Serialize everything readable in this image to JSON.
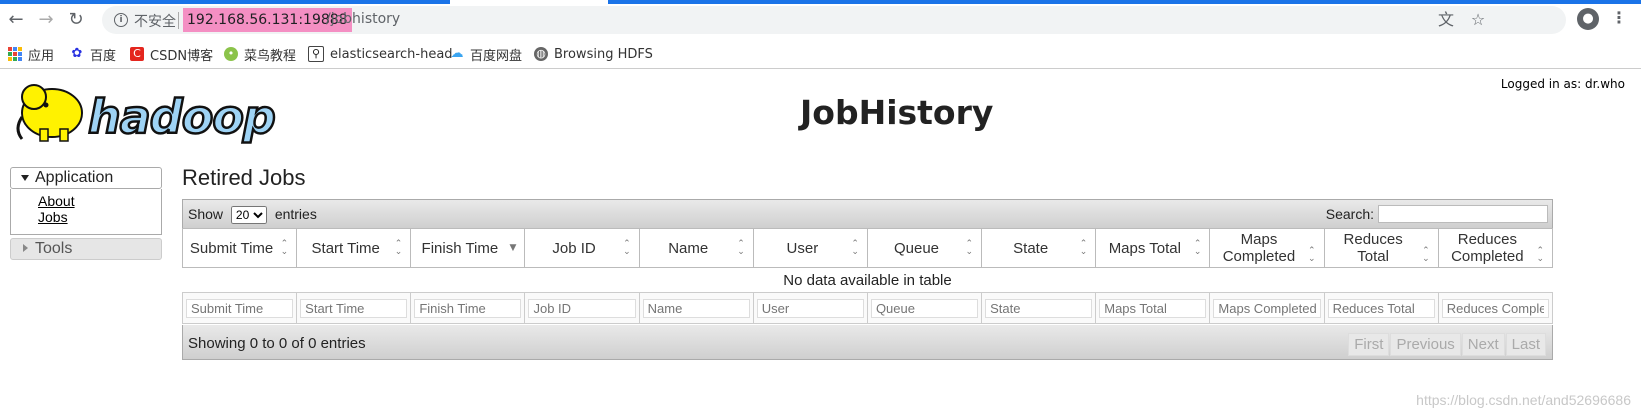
{
  "browser": {
    "insecure_label": "不安全",
    "url_host": "192.168.56.131:19888",
    "url_path": "/jobhistory",
    "bookmarks": [
      {
        "label": "应用",
        "icon": "apps-grid-icon"
      },
      {
        "label": "百度",
        "icon": "baidu-paw-icon"
      },
      {
        "label": "CSDN博客",
        "icon": "csdn-icon"
      },
      {
        "label": "菜鸟教程",
        "icon": "runoob-icon"
      },
      {
        "label": "elasticsearch-head",
        "icon": "elasticsearch-icon"
      },
      {
        "label": "百度网盘",
        "icon": "baidu-pan-icon"
      },
      {
        "label": "Browsing HDFS",
        "icon": "globe-icon"
      }
    ]
  },
  "header": {
    "logged_in": "Logged in as: dr.who",
    "title": "JobHistory"
  },
  "sidebar": {
    "application": "Application",
    "links": [
      "About",
      "Jobs"
    ],
    "tools": "Tools"
  },
  "main": {
    "title": "Retired Jobs",
    "show_prefix": "Show",
    "show_value": "20",
    "show_suffix": "entries",
    "search_label": "Search:",
    "columns": [
      "Submit Time",
      "Start Time",
      "Finish Time",
      "Job ID",
      "Name",
      "User",
      "Queue",
      "State",
      "Maps Total",
      "Maps Completed",
      "Reduces Total",
      "Reduces Completed"
    ],
    "empty_message": "No data available in table",
    "filter_placeholders": [
      "Submit Time",
      "Start Time",
      "Finish Time",
      "Job ID",
      "Name",
      "User",
      "Queue",
      "State",
      "Maps Total",
      "Maps Completed",
      "Reduces Total",
      "Reduces Completed"
    ],
    "info": "Showing 0 to 0 of 0 entries",
    "pager": [
      "First",
      "Previous",
      "Next",
      "Last"
    ]
  },
  "watermark": "https://blog.csdn.net/and52696686",
  "colors": {
    "url_highlight": "#f48fc3",
    "tab_accent": "#1a73e8"
  }
}
